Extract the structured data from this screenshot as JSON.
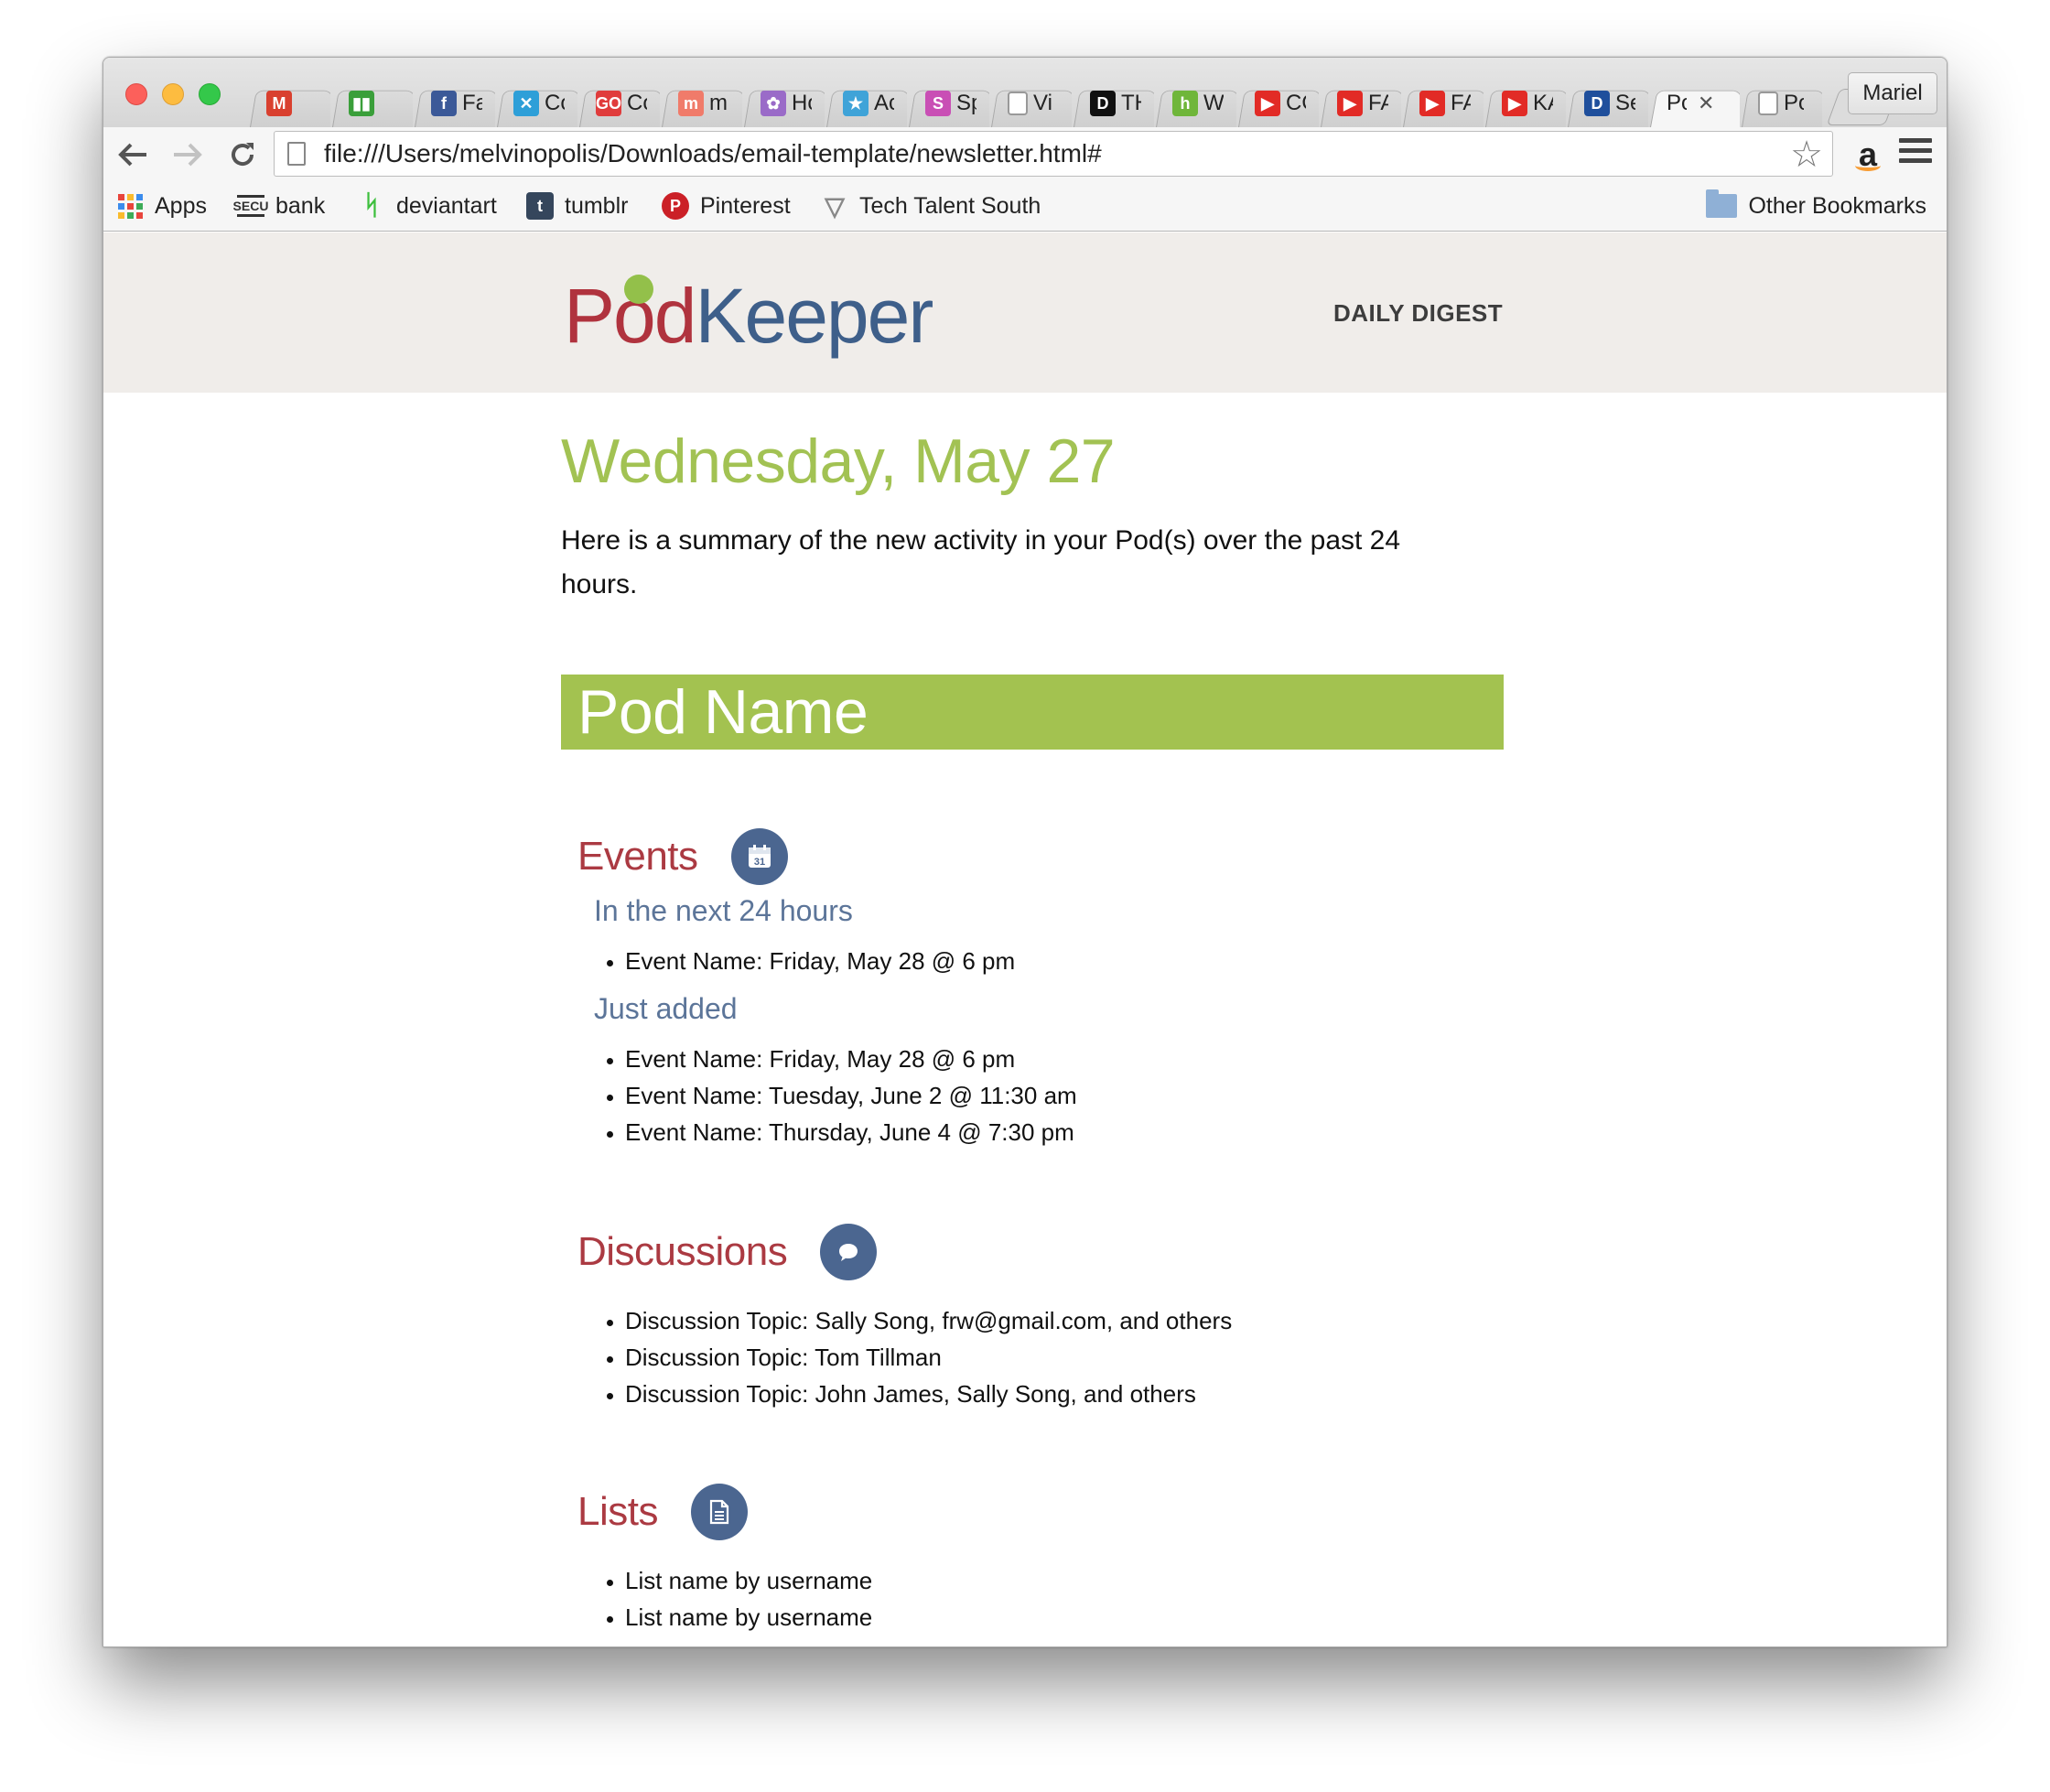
{
  "browser": {
    "tabs": [
      {
        "favicon": "gmail-icon",
        "title": "",
        "color": "#d9402f",
        "glyph": "M"
      },
      {
        "favicon": "trello-icon",
        "title": "",
        "color": "#3a9f3a",
        "glyph": "▮▮"
      },
      {
        "favicon": "facebook-icon",
        "title": "Fa",
        "color": "#3b5998",
        "glyph": "f"
      },
      {
        "favicon": "cross-icon",
        "title": "Co",
        "color": "#2e9fd8",
        "glyph": "✕"
      },
      {
        "favicon": "go-icon",
        "title": "Co",
        "color": "#e03c3c",
        "glyph": "GO"
      },
      {
        "favicon": "m-icon",
        "title": "m",
        "color": "#f07b6a",
        "glyph": "m"
      },
      {
        "favicon": "flower-icon",
        "title": "Ho",
        "color": "#9a6bc8",
        "glyph": "✿"
      },
      {
        "favicon": "star-icon",
        "title": "Ac",
        "color": "#3fa3d8",
        "glyph": "★"
      },
      {
        "favicon": "swirl-icon",
        "title": "Sp",
        "color": "#c94fb5",
        "glyph": "S"
      },
      {
        "favicon": "page-icon",
        "title": "Vi",
        "color": "#ffffff",
        "glyph": ""
      },
      {
        "favicon": "d-icon",
        "title": "TH",
        "color": "#111111",
        "glyph": "D"
      },
      {
        "favicon": "h-icon",
        "title": "W",
        "color": "#6fb63a",
        "glyph": "h"
      },
      {
        "favicon": "youtube-icon",
        "title": "CO",
        "color": "#e22b26",
        "glyph": "▶"
      },
      {
        "favicon": "youtube-icon",
        "title": "FA",
        "color": "#e22b26",
        "glyph": "▶"
      },
      {
        "favicon": "youtube-icon",
        "title": "FA",
        "color": "#e22b26",
        "glyph": "▶"
      },
      {
        "favicon": "youtube-icon",
        "title": "KA",
        "color": "#e22b26",
        "glyph": "▶"
      },
      {
        "favicon": "dmv-icon",
        "title": "Se",
        "color": "#1f4f9c",
        "glyph": "D"
      },
      {
        "favicon": "",
        "title": "Po",
        "color": "",
        "glyph": "",
        "active": true
      },
      {
        "favicon": "page-icon",
        "title": "Po",
        "color": "#ffffff",
        "glyph": ""
      }
    ],
    "profile_name": "Mariel",
    "url": "file:///Users/melvinopolis/Downloads/email-template/newsletter.html#",
    "bookmarks": [
      {
        "label": "Apps",
        "icon": "apps-grid-icon"
      },
      {
        "label": "bank",
        "icon": "secu-icon"
      },
      {
        "label": "deviantart",
        "icon": "deviantart-icon"
      },
      {
        "label": "tumblr",
        "icon": "tumblr-icon"
      },
      {
        "label": "Pinterest",
        "icon": "pinterest-icon"
      },
      {
        "label": "Tech Talent South",
        "icon": "triangle-icon"
      }
    ],
    "other_bookmarks": "Other Bookmarks"
  },
  "page": {
    "logo": {
      "part1": "Pod",
      "part2": "Keeper",
      "color1": "#b0333e",
      "color2": "#3e5f8a",
      "accent": "#93c04a"
    },
    "header_link": "DAILY DIGEST",
    "date": "Wednesday, May 27",
    "summary": "Here is a summary of the new activity in your Pod(s) over the past 24 hours.",
    "pod_name": "Pod Name",
    "events": {
      "title": "Events",
      "icon": "calendar-icon",
      "next_heading": "In the next 24 hours",
      "next_items": [
        "Event Name: Friday, May 28 @ 6 pm"
      ],
      "added_heading": "Just added",
      "added_items": [
        "Event Name: Friday, May 28 @ 6 pm",
        "Event Name: Tuesday, June 2 @ 11:30 am",
        "Event Name: Thursday, June 4 @ 7:30 pm"
      ]
    },
    "discussions": {
      "title": "Discussions",
      "icon": "speech-bubble-icon",
      "items": [
        "Discussion Topic: Sally Song, frw@gmail.com, and others",
        "Discussion Topic: Tom Tillman",
        "Discussion Topic: John James, Sally Song, and others"
      ]
    },
    "lists": {
      "title": "Lists",
      "icon": "document-icon",
      "items": [
        "List name by username",
        "List name by username"
      ]
    },
    "colors": {
      "green": "#a3c250",
      "red": "#ab3a42",
      "blue": "#4b6690",
      "header_bg": "#f0edea"
    }
  }
}
